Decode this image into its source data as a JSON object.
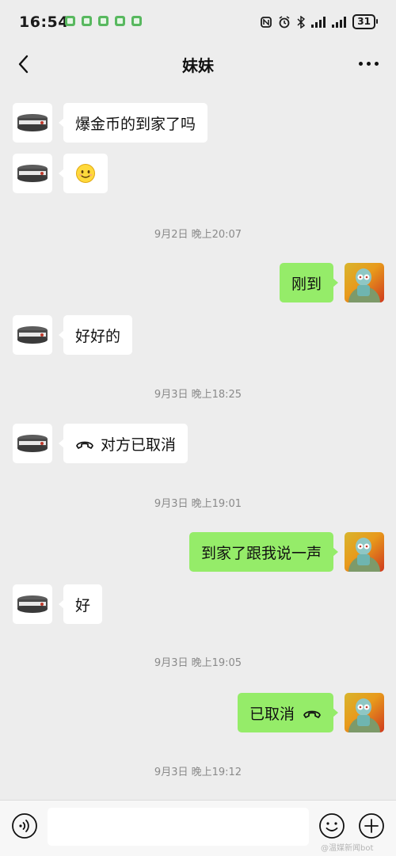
{
  "status_bar": {
    "time": "16:54",
    "battery": "31"
  },
  "header": {
    "title": "妹妹"
  },
  "messages": [
    {
      "side": "left",
      "text": "爆金币的到家了吗"
    },
    {
      "side": "left",
      "text": "",
      "emoji": "smiling-face"
    },
    {
      "side": "right",
      "text": "刚到"
    },
    {
      "side": "left",
      "text": "好好的"
    },
    {
      "side": "left",
      "text": "对方已取消",
      "call": "cancelled"
    },
    {
      "side": "right",
      "text": "到家了跟我说一声"
    },
    {
      "side": "left",
      "text": "好"
    },
    {
      "side": "right",
      "text": "已取消",
      "call": "cancelled"
    }
  ],
  "timestamps": [
    "9月2日 晚上20:07",
    "9月3日 晚上18:25",
    "9月3日 晚上19:01",
    "9月3日 晚上19:05",
    "9月3日 晚上19:12"
  ],
  "input_bar": {
    "value": ""
  },
  "watermark": "@温媒新闻bot",
  "colors": {
    "background": "#ededed",
    "own_bubble": "#95ec69",
    "other_bubble": "#ffffff"
  }
}
